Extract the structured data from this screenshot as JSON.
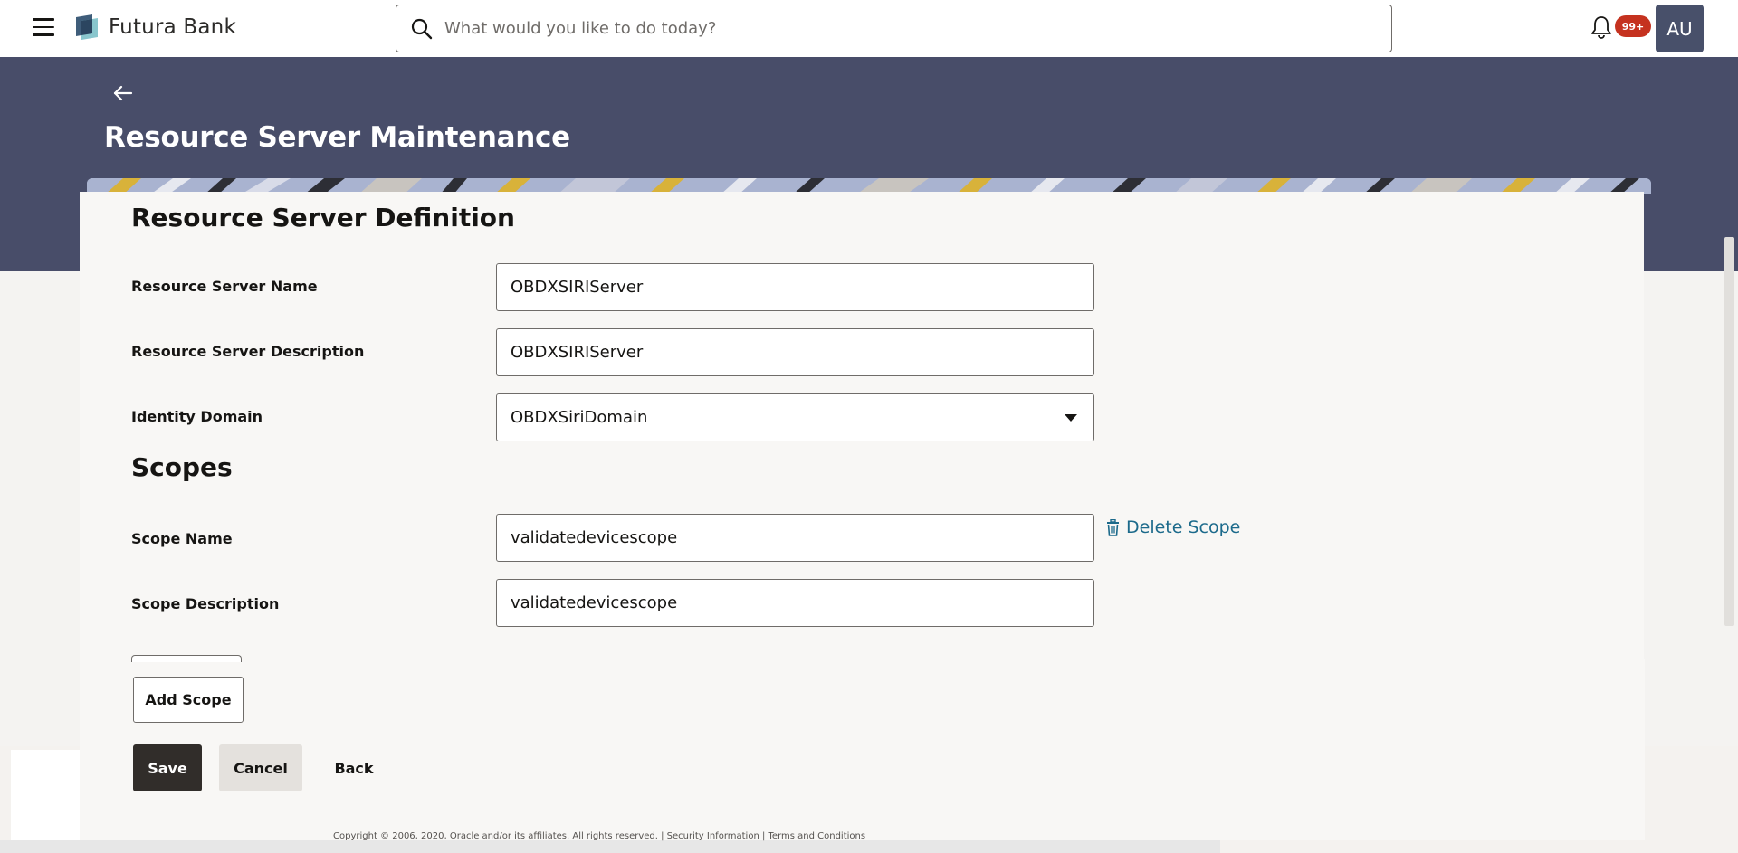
{
  "header": {
    "brand_name": "Futura Bank",
    "search_placeholder": "What would you like to do today?",
    "notification_count": "99+",
    "avatar_initials": "AU"
  },
  "page": {
    "title": "Resource Server Maintenance"
  },
  "definition": {
    "section_title": "Resource Server Definition",
    "name_label": "Resource Server Name",
    "name_value": "OBDXSIRIServer",
    "description_label": "Resource Server Description",
    "description_value": "OBDXSIRIServer",
    "domain_label": "Identity Domain",
    "domain_value": "OBDXSiriDomain"
  },
  "scopes": {
    "section_title": "Scopes",
    "scope_name_label": "Scope Name",
    "scope_name_value": "validatedevicescope",
    "scope_description_label": "Scope Description",
    "scope_description_value": "validatedevicescope",
    "delete_label": "Delete Scope"
  },
  "actions": {
    "add_scope": "Add Scope",
    "save": "Save",
    "cancel": "Cancel",
    "back": "Back"
  },
  "footer": {
    "text": "Copyright © 2006, 2020, Oracle and/or its affiliates. All rights reserved. | Security Information | Terms and Conditions"
  },
  "colors": {
    "banner": "#484d69",
    "avatar": "#48506a",
    "badge": "#c5321f",
    "link": "#1c6a8b",
    "primary_button": "#312d2a"
  }
}
